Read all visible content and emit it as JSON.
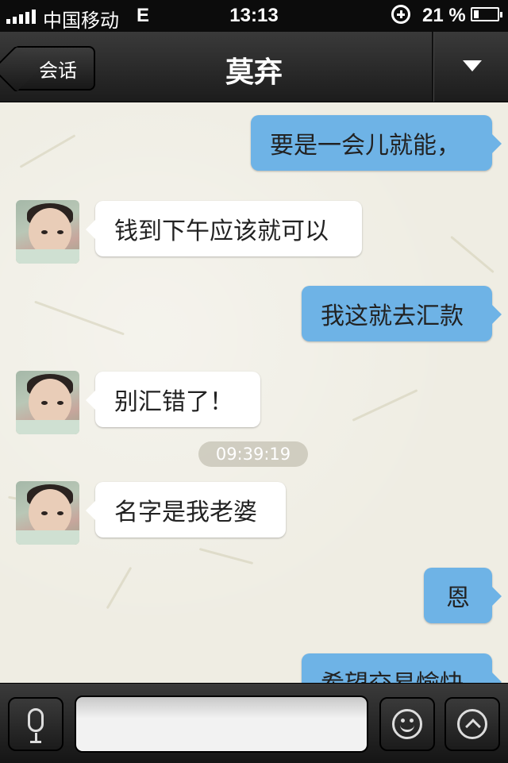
{
  "status_bar": {
    "carrier": "中国移动",
    "network": "E",
    "time": "13:13",
    "battery_percent": "21 %",
    "battery_level": 0.21
  },
  "nav_bar": {
    "back_label": "会话",
    "title": "莫弃"
  },
  "messages": [
    {
      "side": "right",
      "text": "要是一会儿就能，"
    },
    {
      "side": "left",
      "text": "钱到下午应该就可以"
    },
    {
      "side": "right",
      "text": "我这就去汇款"
    },
    {
      "side": "left",
      "text": "别汇错了！"
    },
    {
      "side": "left",
      "text": "名字是我老婆"
    },
    {
      "side": "right",
      "text": "恩"
    },
    {
      "side": "right",
      "text": "希望交易愉快"
    }
  ],
  "timestamp": "09:39:19",
  "colors": {
    "outgoing_bubble": "#6eb3e6",
    "incoming_bubble": "#ffffff",
    "chat_background": "#efede3",
    "bar": "#1c1c1c"
  }
}
